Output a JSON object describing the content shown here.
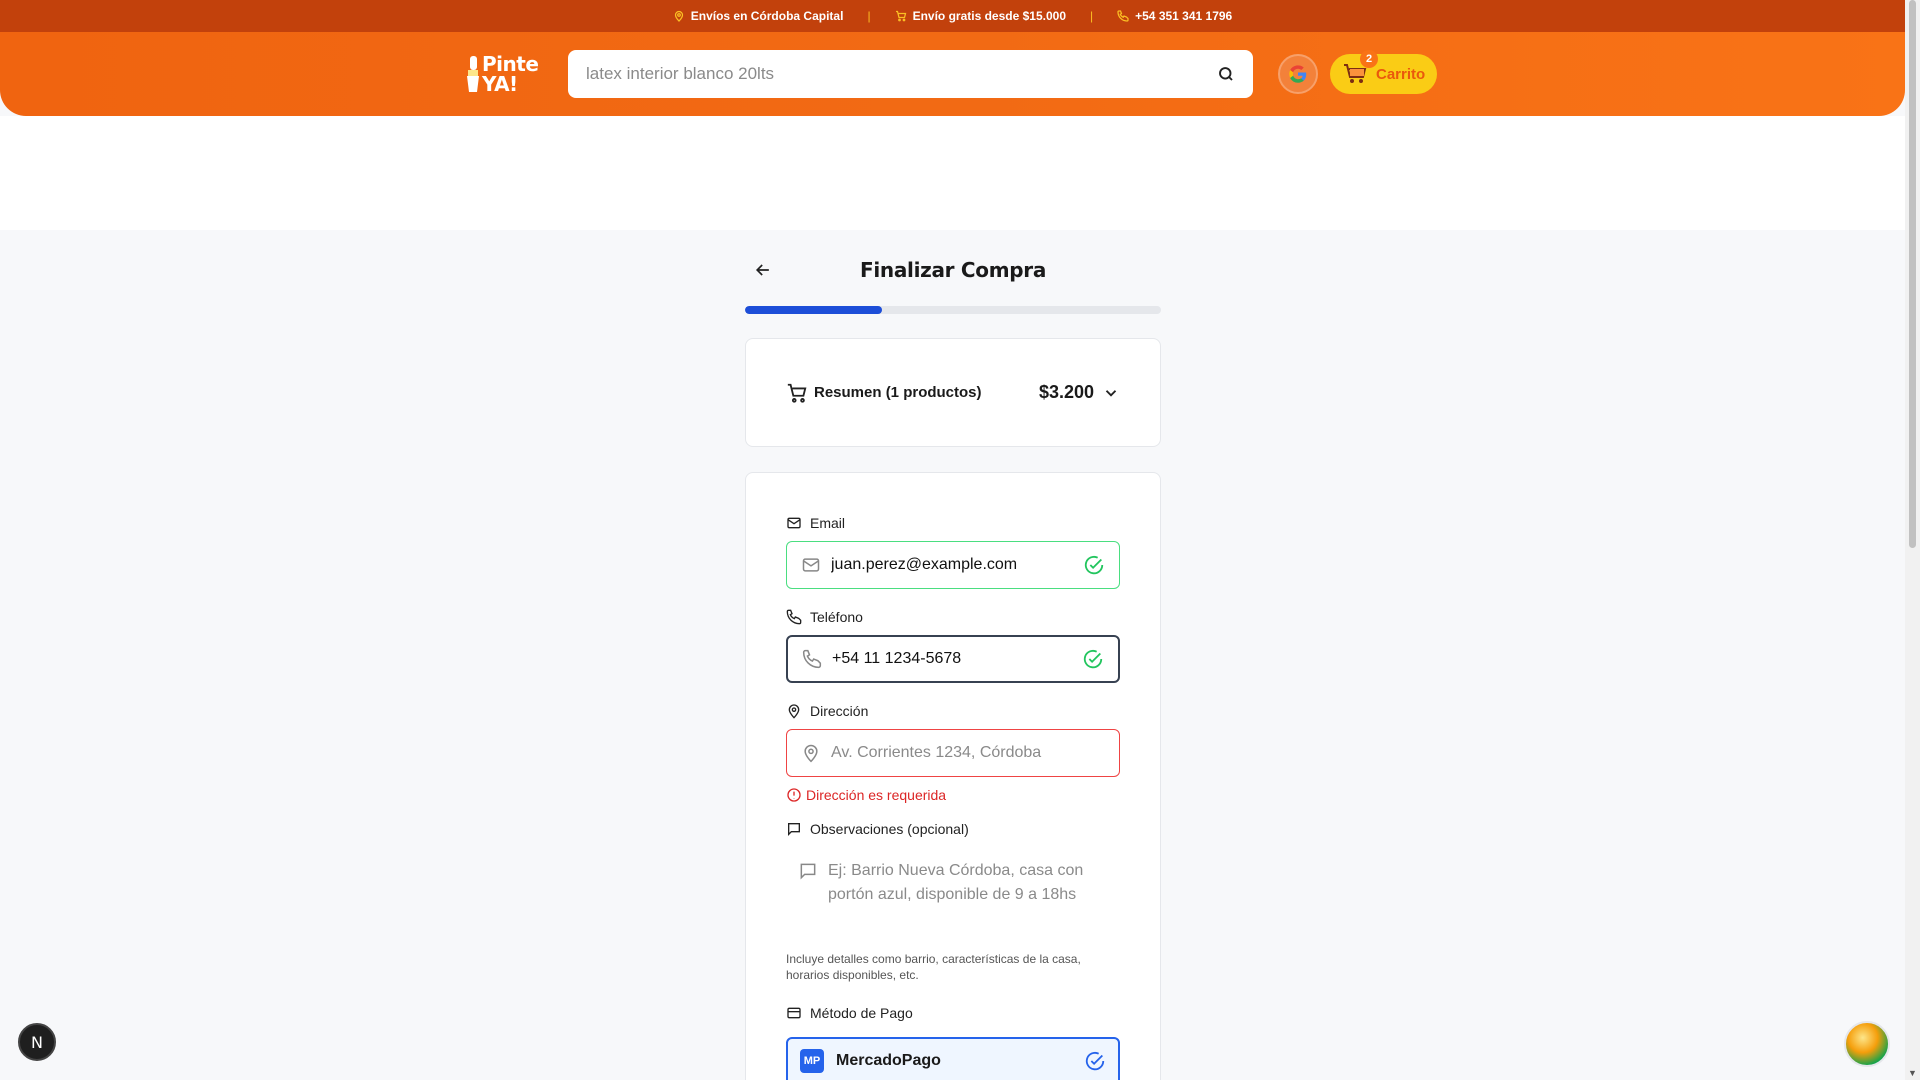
{
  "topbar": {
    "shipping_area": "Envíos en Córdoba Capital",
    "free_shipping": "Envío gratis desde $15.000",
    "phone": "+54 351 341 1796"
  },
  "header": {
    "logo_line1": "Pinte",
    "logo_line2": "YA!",
    "search_placeholder": "latex interior blanco 20lts",
    "cart_label": "Carrito",
    "cart_count": "2"
  },
  "checkout": {
    "title": "Finalizar Compra",
    "progress_percent": 33,
    "summary_label": "Resumen (1 productos)",
    "summary_total": "$3.200"
  },
  "form": {
    "email_label": "Email",
    "email_value": "juan.perez@example.com",
    "phone_label": "Teléfono",
    "phone_value": "+54 11 1234-5678",
    "address_label": "Dirección",
    "address_placeholder": "Av. Corrientes 1234, Córdoba",
    "address_error": "Dirección es requerida",
    "notes_label": "Observaciones (opcional)",
    "notes_placeholder": "Ej: Barrio Nueva Córdoba, casa con portón azul, disponible de 9 a 18hs",
    "notes_hint": "Incluye detalles como barrio, características de la casa, horarios disponibles, etc.",
    "payment_label": "Método de Pago",
    "payment_badge": "MP",
    "payment_option": "MercadoPago"
  },
  "overlay": {
    "next_badge": "N"
  },
  "colors": {
    "brand_orange": "#f26a14",
    "topbar": "#c2410c",
    "cart_yellow": "#facc15",
    "progress_blue": "#1d4ed8",
    "success_green": "#22c55e",
    "error_red": "#dc2626"
  }
}
